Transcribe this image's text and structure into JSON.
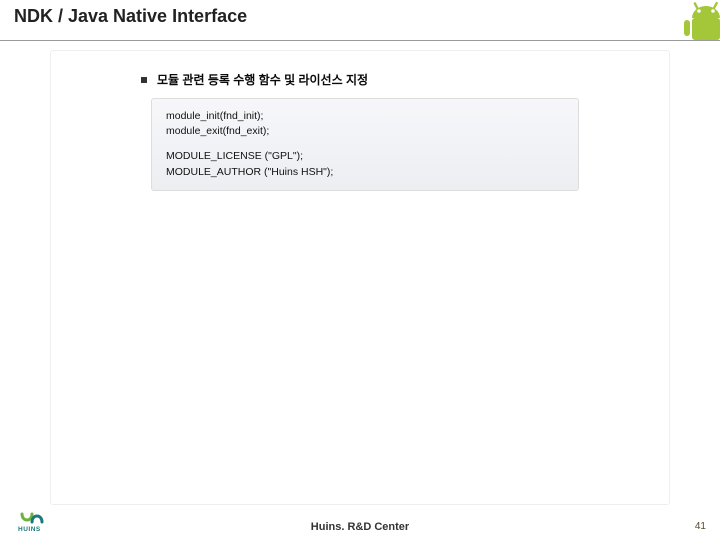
{
  "header": {
    "title": "NDK / Java Native Interface"
  },
  "bullet": {
    "text": "모듈 관련 등록 수행  함수 및 라이선스 지정"
  },
  "code": {
    "l1": "module_init(fnd_init);",
    "l2": "module_exit(fnd_exit);",
    "l3": "MODULE_LICENSE (\"GPL\");",
    "l4": "MODULE_AUTHOR (\"Huins HSH\");"
  },
  "footer": {
    "center": "Huins. R&D Center",
    "page": "41",
    "logo_text": "HUINS"
  },
  "icons": {
    "android": "android-icon",
    "logo": "huins-logo"
  }
}
